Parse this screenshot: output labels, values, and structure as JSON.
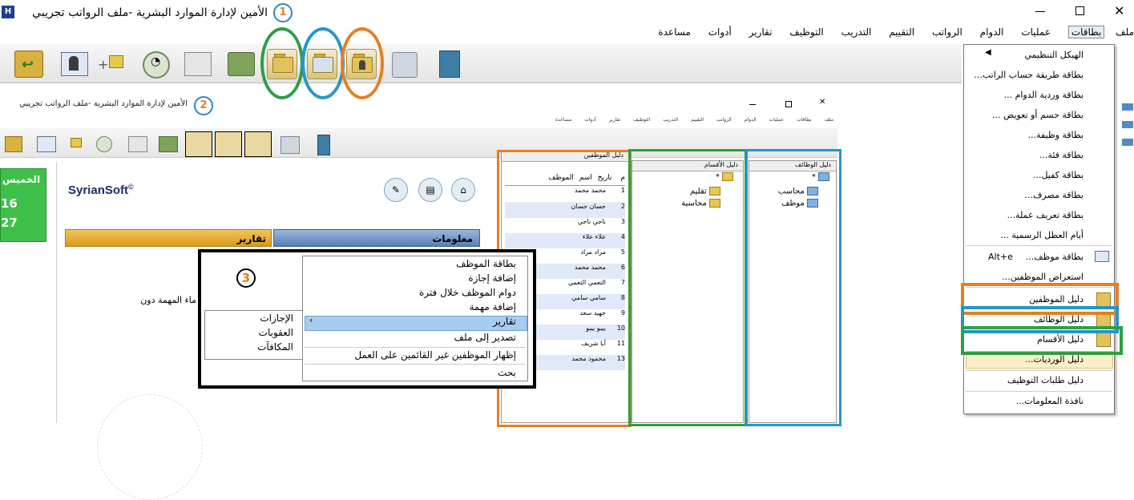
{
  "window": {
    "title": "الأمين لإدارة الموارد البشرية -ملف الرواتب تجريبي",
    "badge1": "1",
    "badge2": "2",
    "badge3": "3",
    "inner_title": "الأمين لإدارة الموارد البشرية -ملف الرواتب تجريبي"
  },
  "menubar": [
    "ملف",
    "بطاقات",
    "عمليات",
    "الدوام",
    "الرواتب",
    "التقييم",
    "التدريب",
    "التوظيف",
    "تقارير",
    "أدوات",
    "مساعدة"
  ],
  "inner_menubar": [
    "ملف",
    "بطاقات",
    "عمليات",
    "الدوام",
    "الرواتب",
    "التقييم",
    "التدريب",
    "التوظيف",
    "تقارير",
    "أدوات",
    "مساعدة"
  ],
  "dropdown": {
    "items": [
      "الهيكل التنظيمي",
      "بطاقة طريقة حساب الراتب...",
      "بطاقة وردية الدوام ...",
      "بطاقة حسم أو تعويض ...",
      "بطاقة وظيفة...",
      "بطاقة فئة...",
      "بطاقة كفيل...",
      "بطاقة مصرف...",
      "بطاقة تعريف عملة...",
      "أيام العطل الرسمية ...",
      "بطاقة موظف...",
      "استعراض الموظفين...",
      "دليل الموظفين",
      "دليل الوظائف",
      "دليل الأقسام",
      "دليل الورديات...",
      "دليل طلبات التوظيف",
      "نافذة المعلومات..."
    ],
    "shortcut": "Alt+e"
  },
  "main": {
    "brand": "SyrianSoft",
    "copyright": "©",
    "tab_info": "معلومات",
    "tab_reports": "تقارير",
    "side_text": "ماء المهمة دون",
    "day_tile": {
      "day": "الخميس",
      "n1": "16",
      "n2": "27"
    }
  },
  "panels": {
    "employees": {
      "title": "دليل الموظفين",
      "headers": [
        "م",
        "تاريخ",
        "اسم",
        "الموظف"
      ],
      "rows": [
        {
          "n": "1",
          "name": "محمد محمد"
        },
        {
          "n": "2",
          "name": "حسان حسان"
        },
        {
          "n": "3",
          "name": "ناجي ناجي"
        },
        {
          "n": "4",
          "name": "علاء علاء"
        },
        {
          "n": "5",
          "name": "مراد مراد"
        },
        {
          "n": "6",
          "name": "محمد محمد"
        },
        {
          "n": "7",
          "name": "التعمي التعمي"
        },
        {
          "n": "8",
          "name": "سامي سامي"
        },
        {
          "n": "9",
          "name": "جهيد سعد"
        },
        {
          "n": "10",
          "name": "بيبو بيبو"
        },
        {
          "n": "11",
          "name": "أبا شريف"
        },
        {
          "n": "13",
          "name": "محمود محمد"
        }
      ]
    },
    "departments": {
      "title": "دليل الأقسام",
      "items": [
        "*",
        "تقليم",
        "محاسبة"
      ]
    },
    "jobs": {
      "title": "دليل الوظائف",
      "items": [
        "*",
        "محاسب",
        "موظف"
      ]
    }
  },
  "context": {
    "items": [
      "بطاقة الموظف",
      "إضافة إجازة",
      "دوام الموظف خلال فترة",
      "إضافة مهمة",
      "تقارير",
      "تصدير إلى ملف",
      "إظهار الموظفين غير القائمين على العمل",
      "بحث"
    ],
    "submenu": [
      "الإجازات",
      "العقوبات",
      "المكافآت"
    ]
  },
  "colors": {
    "green": "#2e9e45",
    "blue": "#2596c8",
    "orange": "#e67e22",
    "black": "#000000"
  }
}
